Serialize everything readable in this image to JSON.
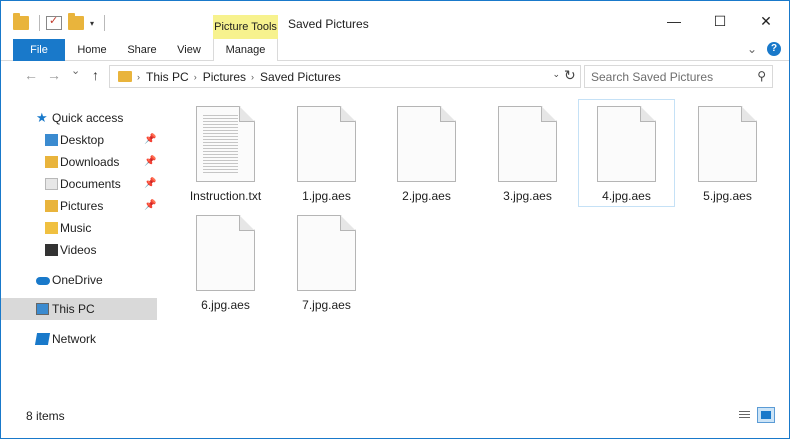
{
  "window": {
    "title": "Saved Pictures",
    "context_tab": "Picture Tools",
    "caption_buttons": [
      "—",
      "☐",
      "✕"
    ]
  },
  "ribbon": {
    "tabs": [
      "File",
      "Home",
      "Share",
      "View",
      "Manage"
    ],
    "expand_icon": "chevron-down-icon",
    "help_label": "?"
  },
  "navigation": {
    "back_glyph": "←",
    "forward_glyph": "→",
    "history_glyph": "⌄",
    "up_glyph": "↑",
    "breadcrumbs": [
      "This PC",
      "Saved Pictures"
    ],
    "breadcrumb_root": "This PC",
    "breadcrumb_mid": "Pictures",
    "breadcrumb_leaf": "Saved Pictures",
    "search_placeholder": "Search Saved Pictures"
  },
  "sidebar": {
    "items": [
      {
        "label": "Quick access"
      },
      {
        "label": "Desktop"
      },
      {
        "label": "Downloads"
      },
      {
        "label": "Documents"
      },
      {
        "label": "Pictures"
      },
      {
        "label": "Music"
      },
      {
        "label": "Videos"
      },
      {
        "label": "OneDrive"
      },
      {
        "label": "This PC"
      },
      {
        "label": "Network"
      }
    ]
  },
  "files": [
    {
      "name": "Instruction.txt",
      "type": "text"
    },
    {
      "name": "1.jpg.aes",
      "type": "blank"
    },
    {
      "name": "2.jpg.aes",
      "type": "blank"
    },
    {
      "name": "3.jpg.aes",
      "type": "blank"
    },
    {
      "name": "4.jpg.aes",
      "type": "blank"
    },
    {
      "name": "5.jpg.aes",
      "type": "blank"
    },
    {
      "name": "6.jpg.aes",
      "type": "blank"
    },
    {
      "name": "7.jpg.aes",
      "type": "blank"
    }
  ],
  "status": {
    "item_count": "8 items"
  },
  "colors": {
    "accent": "#1979ca",
    "context_tab_bg": "#f7f28e",
    "folder": "#e9b43c",
    "selection": "#d9d9d9"
  }
}
